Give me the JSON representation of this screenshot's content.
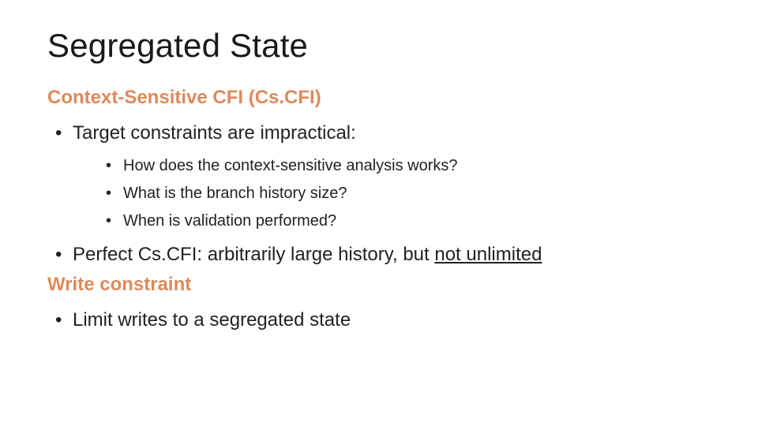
{
  "title": "Segregated State",
  "section1": "Context-Sensitive CFI (Cs.CFI)",
  "b1": "Target constraints are impractical:",
  "sub": {
    "a": "How does the context-sensitive analysis works?",
    "b": "What is the branch history size?",
    "c": "When is validation performed?"
  },
  "b2_prefix": "Perfect Cs.CFI: arbitrarily large history, but ",
  "b2_underlined": "not unlimited",
  "section2": "Write constraint",
  "b3": "Limit writes to a segregated state"
}
